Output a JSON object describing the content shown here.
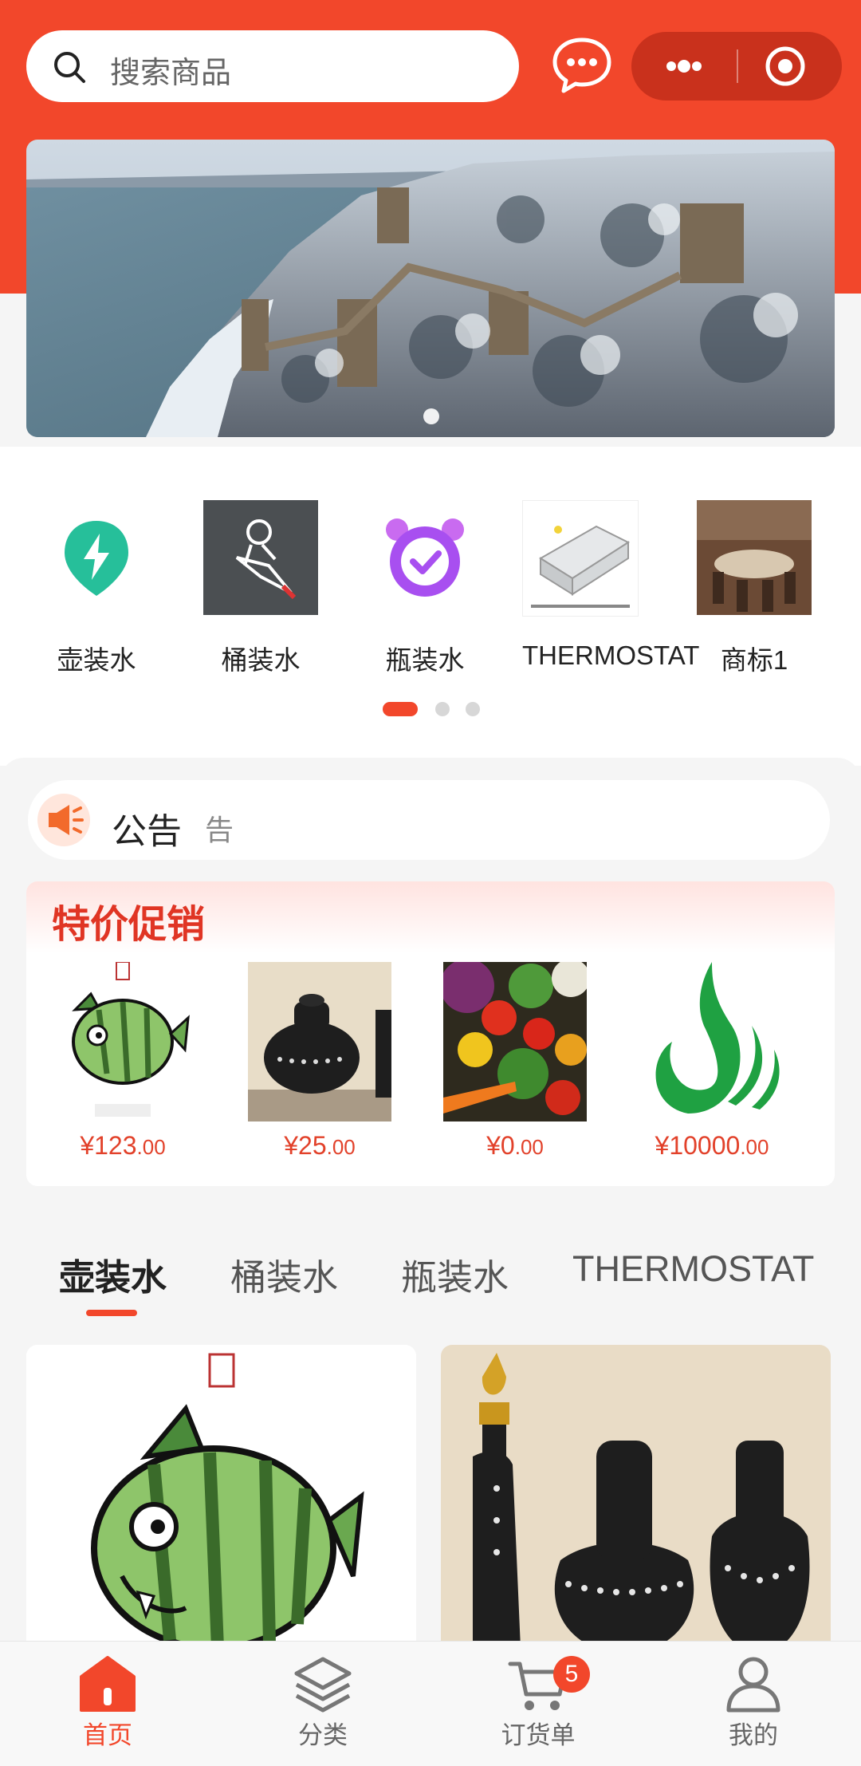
{
  "search": {
    "placeholder": "搜索商品"
  },
  "categories": [
    {
      "label": "壶装水",
      "icon": "lightning-pin-icon"
    },
    {
      "label": "桶装水",
      "icon": "rocket-astronaut-icon"
    },
    {
      "label": "瓶装水",
      "icon": "alarm-check-icon"
    },
    {
      "label": "THERMOSTAT",
      "icon": "thermostat-product-image"
    },
    {
      "label": "商标1",
      "icon": "dining-room-image"
    }
  ],
  "notice": {
    "title": "公告",
    "text": "告"
  },
  "promo": {
    "title": "特价促销",
    "items": [
      {
        "currency": "¥",
        "int": "123",
        "dec": ".00",
        "image": "watermelon-shark-image"
      },
      {
        "currency": "¥",
        "int": "25",
        "dec": ".00",
        "image": "black-pottery-image"
      },
      {
        "currency": "¥",
        "int": "0",
        "dec": ".00",
        "image": "vegetables-image"
      },
      {
        "currency": "¥",
        "int": "10000",
        "dec": ".00",
        "image": "green-logo-image"
      }
    ]
  },
  "tabs": [
    "壶装水",
    "桶装水",
    "瓶装水",
    "THERMOSTAT"
  ],
  "bottom_nav": [
    {
      "label": "首页",
      "icon": "home-icon",
      "active": true
    },
    {
      "label": "分类",
      "icon": "layers-icon"
    },
    {
      "label": "订货单",
      "icon": "cart-icon",
      "badge": "5"
    },
    {
      "label": "我的",
      "icon": "user-icon"
    }
  ],
  "colors": {
    "primary": "#f2472b",
    "price": "#e2412a",
    "capsule": "#c9311c"
  }
}
